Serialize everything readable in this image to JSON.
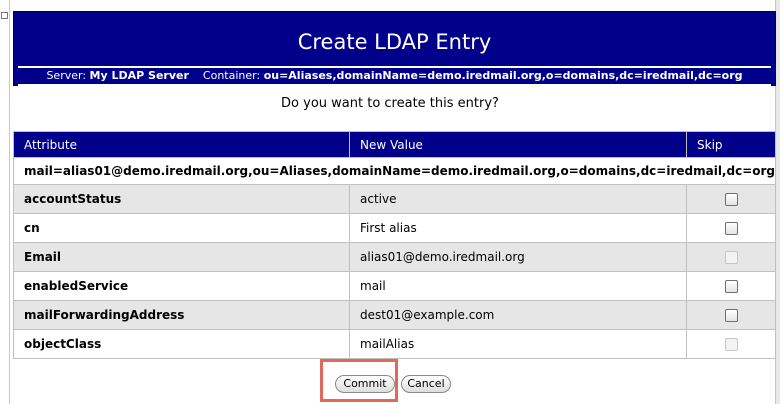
{
  "banner": {
    "title": "Create LDAP Entry",
    "server_label": "Server:",
    "server_value": "My LDAP Server",
    "container_label": "Container:",
    "container_value": "ou=Aliases,domainName=demo.iredmail.org,o=domains,dc=iredmail,dc=org"
  },
  "question": "Do you want to create this entry?",
  "table": {
    "headers": {
      "attribute": "Attribute",
      "new_value": "New Value",
      "skip": "Skip"
    },
    "dn": "mail=alias01@demo.iredmail.org,ou=Aliases,domainName=demo.iredmail.org,o=domains,dc=iredmail,dc=org",
    "rows": [
      {
        "attribute": "accountStatus",
        "value": "active",
        "skip_enabled": true
      },
      {
        "attribute": "cn",
        "value": "First alias",
        "skip_enabled": true
      },
      {
        "attribute": "Email",
        "value": "alias01@demo.iredmail.org",
        "skip_enabled": false
      },
      {
        "attribute": "enabledService",
        "value": "mail",
        "skip_enabled": true
      },
      {
        "attribute": "mailForwardingAddress",
        "value": "dest01@example.com",
        "skip_enabled": true
      },
      {
        "attribute": "objectClass",
        "value": "mailAlias",
        "skip_enabled": false
      }
    ]
  },
  "actions": {
    "commit_label": "Commit",
    "cancel_label": "Cancel",
    "highlight_color": "#e2685d"
  },
  "colors": {
    "header_bg": "#00008b",
    "row_alt_bg": "#e6e6e6"
  }
}
